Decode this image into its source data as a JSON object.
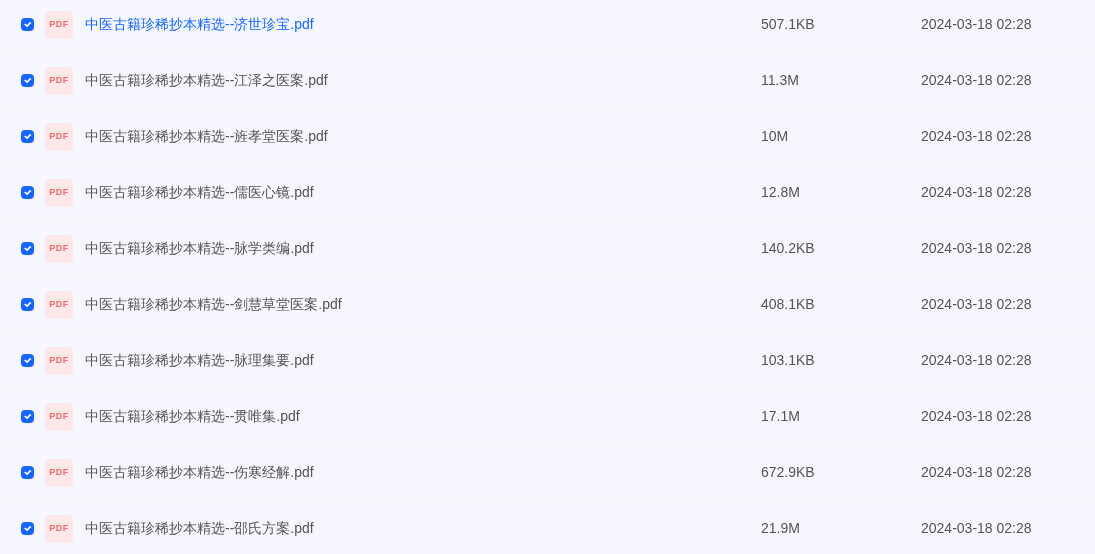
{
  "files": [
    {
      "name": "中医古籍珍稀抄本精选--济世珍宝.pdf",
      "icon_label": "PDF",
      "size": "507.1KB",
      "date": "2024-03-18 02:28",
      "checked": true,
      "highlighted": true
    },
    {
      "name": "中医古籍珍稀抄本精选--江泽之医案.pdf",
      "icon_label": "PDF",
      "size": "11.3M",
      "date": "2024-03-18 02:28",
      "checked": true,
      "highlighted": false
    },
    {
      "name": "中医古籍珍稀抄本精选--旌孝堂医案.pdf",
      "icon_label": "PDF",
      "size": "10M",
      "date": "2024-03-18 02:28",
      "checked": true,
      "highlighted": false
    },
    {
      "name": "中医古籍珍稀抄本精选--儒医心镜.pdf",
      "icon_label": "PDF",
      "size": "12.8M",
      "date": "2024-03-18 02:28",
      "checked": true,
      "highlighted": false
    },
    {
      "name": "中医古籍珍稀抄本精选--脉学类编.pdf",
      "icon_label": "PDF",
      "size": "140.2KB",
      "date": "2024-03-18 02:28",
      "checked": true,
      "highlighted": false
    },
    {
      "name": "中医古籍珍稀抄本精选--剑慧草堂医案.pdf",
      "icon_label": "PDF",
      "size": "408.1KB",
      "date": "2024-03-18 02:28",
      "checked": true,
      "highlighted": false
    },
    {
      "name": "中医古籍珍稀抄本精选--脉理集要.pdf",
      "icon_label": "PDF",
      "size": "103.1KB",
      "date": "2024-03-18 02:28",
      "checked": true,
      "highlighted": false
    },
    {
      "name": "中医古籍珍稀抄本精选--贯唯集.pdf",
      "icon_label": "PDF",
      "size": "17.1M",
      "date": "2024-03-18 02:28",
      "checked": true,
      "highlighted": false
    },
    {
      "name": "中医古籍珍稀抄本精选--伤寒经解.pdf",
      "icon_label": "PDF",
      "size": "672.9KB",
      "date": "2024-03-18 02:28",
      "checked": true,
      "highlighted": false
    },
    {
      "name": "中医古籍珍稀抄本精选--邵氏方案.pdf",
      "icon_label": "PDF",
      "size": "21.9M",
      "date": "2024-03-18 02:28",
      "checked": true,
      "highlighted": false
    }
  ]
}
